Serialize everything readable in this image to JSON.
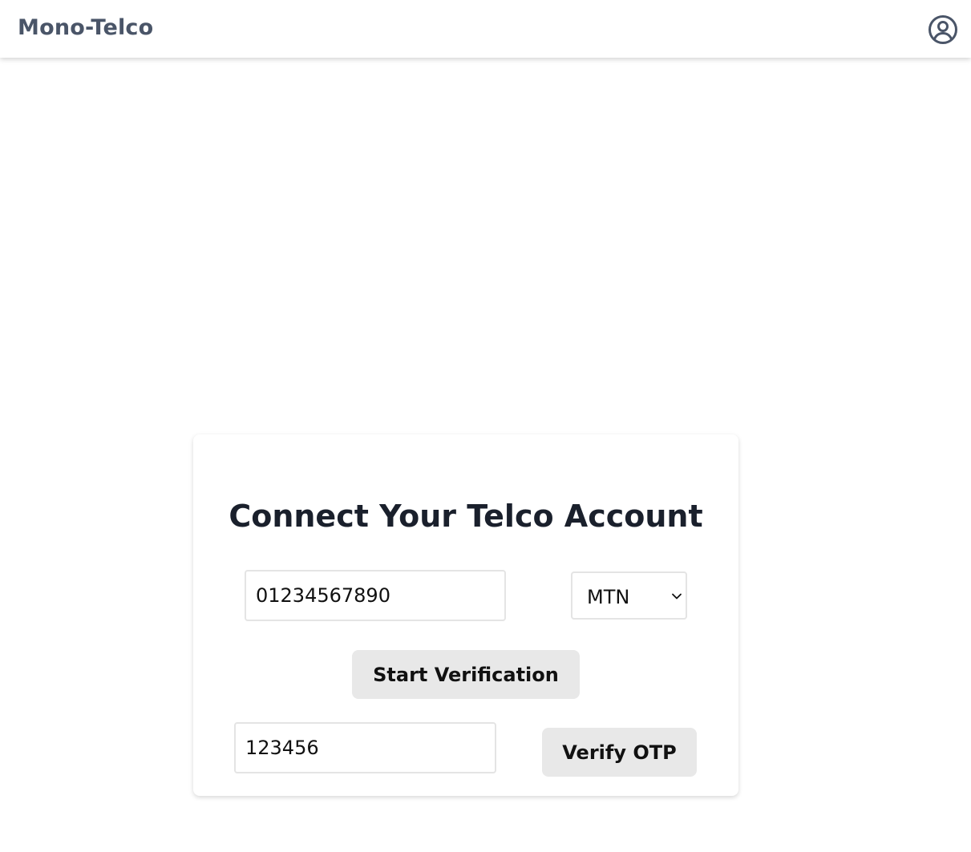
{
  "header": {
    "brand": "Mono-Telco",
    "account_icon": "user-circle-icon"
  },
  "card": {
    "title": "Connect Your Telco Account",
    "phone_input": {
      "value": "01234567890"
    },
    "network_select": {
      "selected": "MTN",
      "chevron_icon": "chevron-down-icon"
    },
    "start_button_label": "Start Verification",
    "otp_input": {
      "value": "123456"
    },
    "verify_button_label": "Verify OTP"
  },
  "colors": {
    "brand_text": "#4a5568",
    "title_text": "#1a202c",
    "button_bg": "#e8e8e8",
    "input_border": "#e4e4e4"
  }
}
